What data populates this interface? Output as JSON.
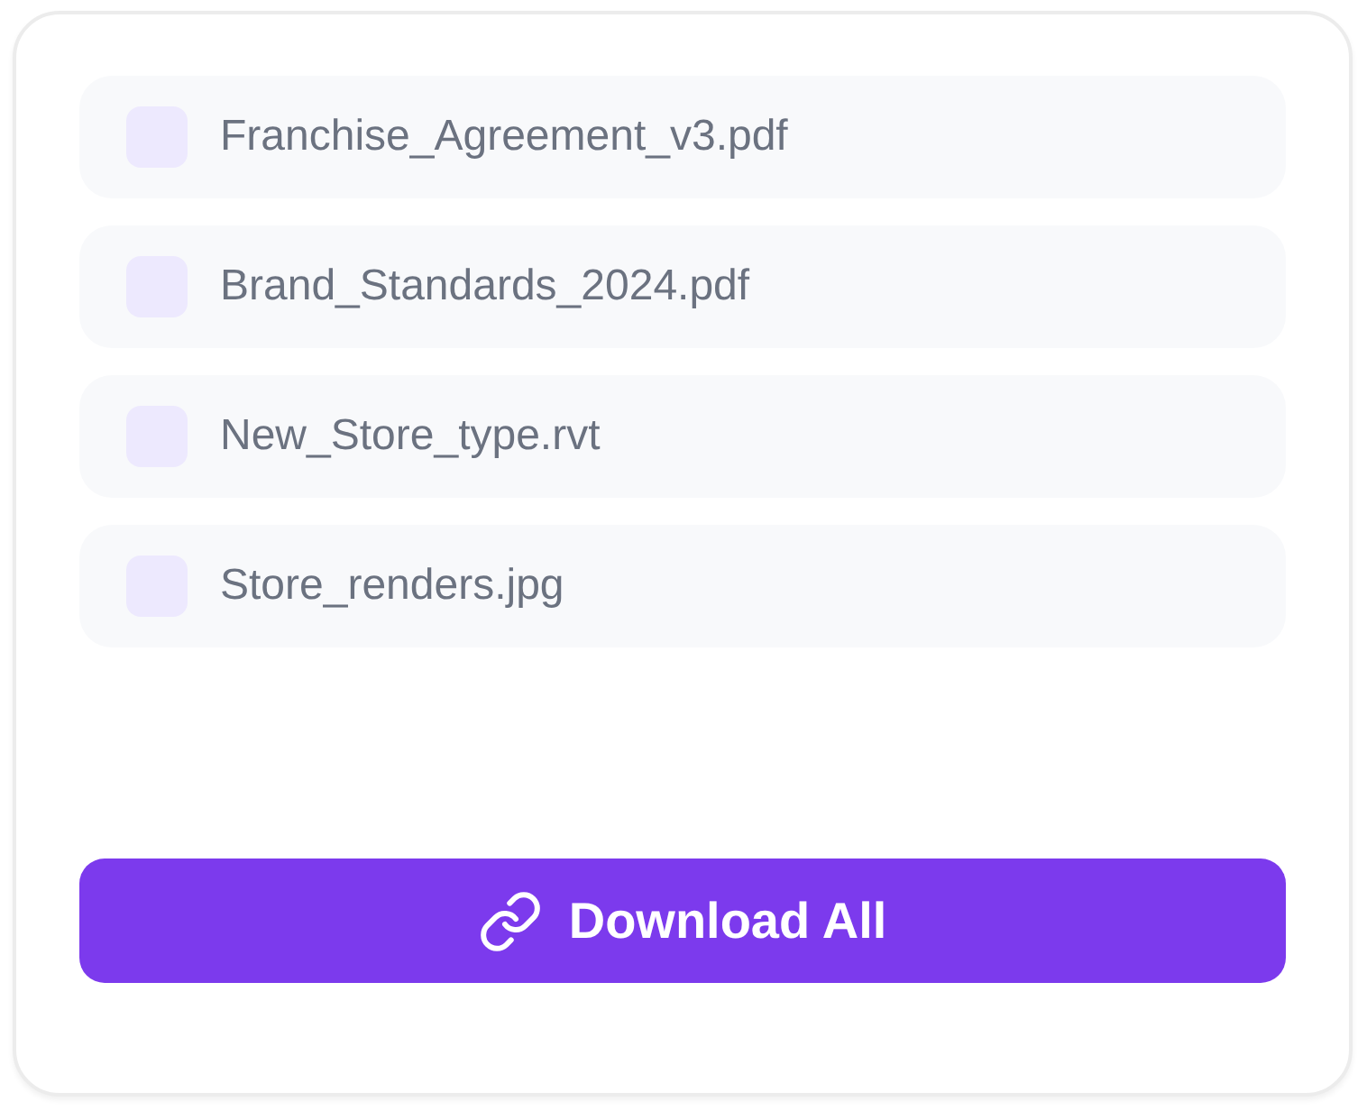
{
  "files": [
    {
      "name": "Franchise_Agreement_v3.pdf"
    },
    {
      "name": "Brand_Standards_2024.pdf"
    },
    {
      "name": "New_Store_type.rvt"
    },
    {
      "name": "Store_renders.jpg"
    }
  ],
  "download_button": {
    "label": "Download All"
  }
}
